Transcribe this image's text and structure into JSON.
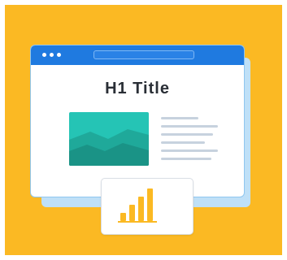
{
  "colors": {
    "background": "#fbb923",
    "browser_frame": "#1f7ae0",
    "back_window": "#bfe0f7",
    "image_fill": "#25c4b5",
    "text_lines": "#c7d2de",
    "chart_bars": "#fbb923"
  },
  "illustration": {
    "title": "H1 Title",
    "titlebar_icon": "window-controls-icon",
    "image_icon": "image-placeholder-icon",
    "chart_icon": "bar-chart-icon",
    "chart_data": {
      "type": "bar",
      "values": [
        1,
        2,
        3,
        4
      ]
    }
  }
}
